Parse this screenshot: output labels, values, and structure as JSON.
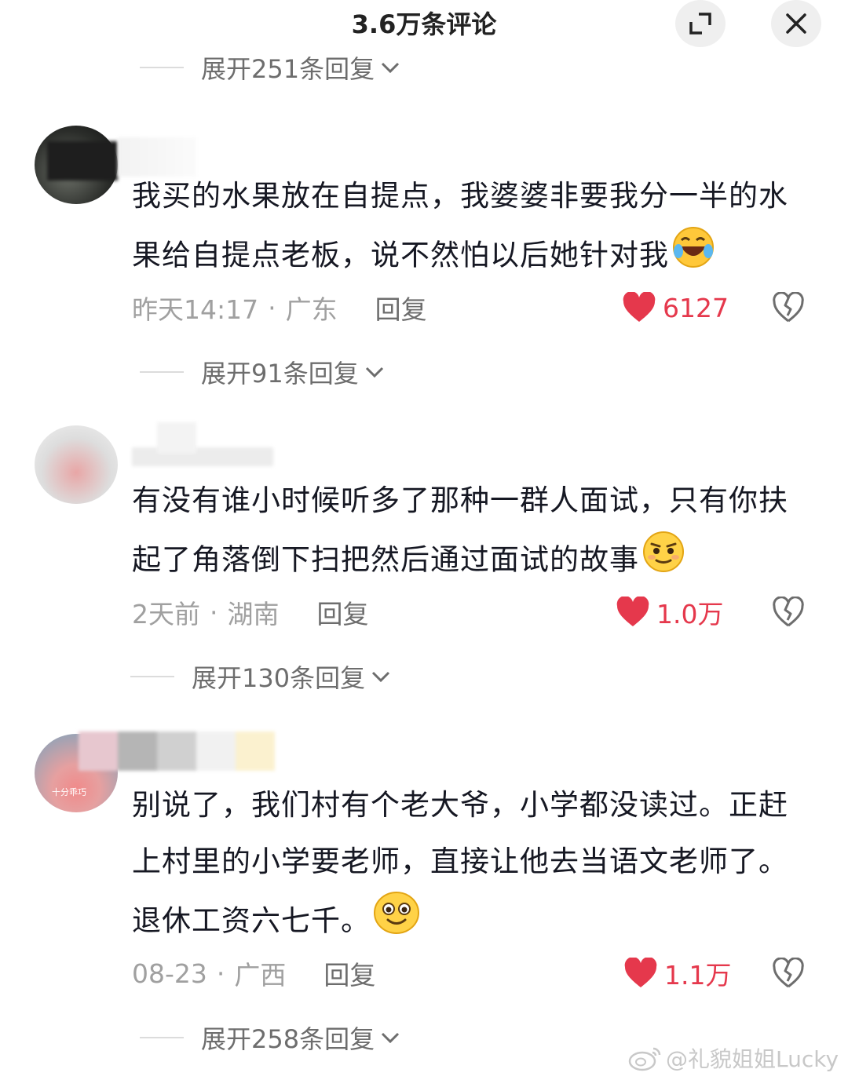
{
  "header": {
    "title": "3.6万条评论"
  },
  "threads": [
    {
      "expand_label": "展开251条回复"
    },
    {
      "text": "我买的水果放在自提点，我婆婆非要我分一半的水果给自提点老板，说不然怕以后她针对我",
      "emoji": "laughing-crying-emoji",
      "time": "昨天14:17",
      "location": "广东",
      "reply": "回复",
      "likes": "6127",
      "expand_label": "展开91条回复"
    },
    {
      "text": "有没有谁小时候听多了那种一群人面试，只有你扶起了角落倒下扫把然后通过面试的故事",
      "emoji": "smirk-emoji",
      "time": "2天前",
      "location": "湖南",
      "reply": "回复",
      "likes": "1.0万",
      "expand_label": "展开130条回复"
    },
    {
      "text": "别说了，我们村有个老大爷，小学都没读过。正赶上村里的小学要老师，直接让他去当语文老师了。退休工资六七千。",
      "emoji": "grin-emoji",
      "time": "08-23",
      "location": "广西",
      "reply": "回复",
      "likes": "1.1万",
      "expand_label": "展开258条回复"
    }
  ],
  "avatar3_badge": "十分乖巧",
  "watermark": "@礼貌姐姐Lucky",
  "colors": {
    "like_red": "#e5384c",
    "meta_gray": "#a0a0a0",
    "text_dark": "#161823"
  }
}
